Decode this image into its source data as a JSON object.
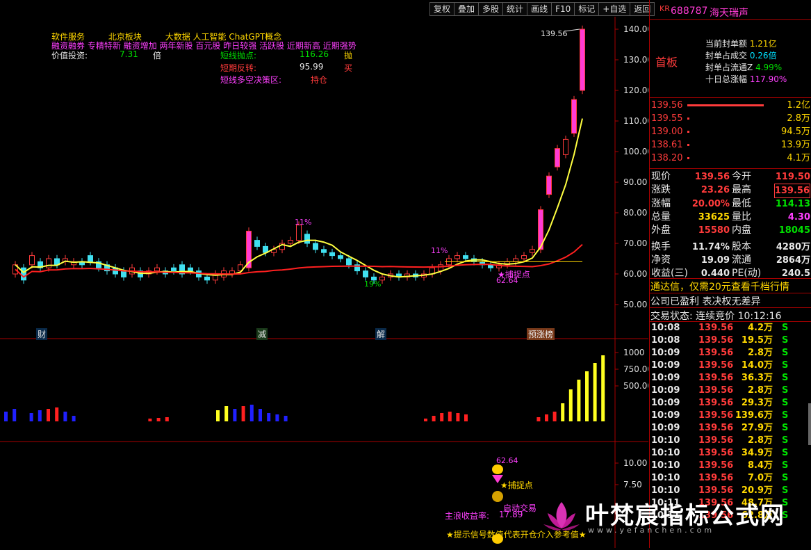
{
  "toolbar": [
    "复权",
    "叠加",
    "多股",
    "统计",
    "画线",
    "F10",
    "标记",
    "+自选",
    "返回"
  ],
  "stock": {
    "prefix": "KR",
    "code": "688787",
    "name": "海天瑞声"
  },
  "header_labels": {
    "row1": [
      "软件服务",
      "北京板块",
      "大数据",
      "人工智能",
      "ChatGPT概念"
    ],
    "row2": [
      "融资融券",
      "专精特新",
      "融资增加",
      "两年新股",
      "百元股",
      "昨日较强",
      "活跃股",
      "近期新高",
      "近期强势"
    ],
    "value_invest_label": "价值投资:",
    "value_invest_value": "7.31",
    "value_invest_unit": "倍",
    "short_sell_label": "短线抛点:",
    "short_sell_value": "116.26",
    "short_sell_action": "抛",
    "short_rev_label": "短期反转:",
    "short_rev_value": "95.99",
    "short_rev_action": "买",
    "decision_label": "短线多空决策区:",
    "decision_value": "持仓"
  },
  "price_axis": [
    "140.00",
    "130.00",
    "120.00",
    "110.00",
    "100.00",
    "90.00",
    "80.00",
    "70.00",
    "60.00",
    "50.00"
  ],
  "volume_axis": [
    "1000",
    "750.00",
    "500.00"
  ],
  "ind_axis": [
    "10.00",
    "7.50"
  ],
  "annotations": {
    "peak": "139.56",
    "pct1": "11%",
    "pct2": "11%",
    "pct3": "19%",
    "catch": "★捕捉点",
    "low": "62.64",
    "marks": [
      "财",
      "减",
      "解",
      "预涨榜"
    ]
  },
  "bottom": {
    "val": "62.64",
    "catch": "★捕捉点",
    "trade": "启动交易",
    "main_label": "主浪收益率:",
    "main_value": "17.89",
    "tip": "★提示信号数值代表开仓介入参考值★"
  },
  "limit_up": {
    "tag": "首板",
    "rows": [
      {
        "label": "当前封单额",
        "value": "1.21亿"
      },
      {
        "label": "封单占成交",
        "value": "0.26倍"
      },
      {
        "label": "封单占流通Z",
        "value": "4.99%"
      },
      {
        "label": "十日总涨幅",
        "value": "117.90%"
      }
    ]
  },
  "order_book": [
    {
      "price": "139.56",
      "vol": "1.2亿"
    },
    {
      "price": "139.55",
      "vol": "2.8万"
    },
    {
      "price": "139.00",
      "vol": "94.5万"
    },
    {
      "price": "138.61",
      "vol": "13.9万"
    },
    {
      "price": "138.20",
      "vol": "4.1万"
    }
  ],
  "quote": [
    {
      "l1": "现价",
      "v1": "139.56",
      "l2": "今开",
      "v2": "119.50"
    },
    {
      "l1": "涨跌",
      "v1": "23.26",
      "l2": "最高",
      "v2": "139.56"
    },
    {
      "l1": "涨幅",
      "v1": "20.00%",
      "l2": "最低",
      "v2": "114.13"
    },
    {
      "l1": "总量",
      "v1": "33625",
      "l2": "量比",
      "v2": "4.30"
    },
    {
      "l1": "外盘",
      "v1": "15580",
      "l2": "内盘",
      "v2": "18045"
    },
    {
      "l1": "换手",
      "v1": "11.74%",
      "l2": "股本",
      "v2": "4280万"
    },
    {
      "l1": "净资",
      "v1": "19.09",
      "l2": "流通",
      "v2": "2864万"
    },
    {
      "l1": "收益(三)",
      "v1": "0.440",
      "l2": "PE(动)",
      "v2": "240.5"
    }
  ],
  "notices": [
    "通达信，仅需20元查看千档行情",
    "公司已盈利 表决权无差异",
    "交易状态: 连续竞价 10:12:16"
  ],
  "trades": [
    {
      "t": "10:08",
      "p": "139.56",
      "v": "4.2万",
      "s": "S"
    },
    {
      "t": "10:08",
      "p": "139.56",
      "v": "19.5万",
      "s": "S"
    },
    {
      "t": "10:09",
      "p": "139.56",
      "v": "2.8万",
      "s": "S"
    },
    {
      "t": "10:09",
      "p": "139.56",
      "v": "14.0万",
      "s": "S"
    },
    {
      "t": "10:09",
      "p": "139.56",
      "v": "36.3万",
      "s": "S"
    },
    {
      "t": "10:09",
      "p": "139.56",
      "v": "2.8万",
      "s": "S"
    },
    {
      "t": "10:09",
      "p": "139.56",
      "v": "29.3万",
      "s": "S"
    },
    {
      "t": "10:09",
      "p": "139.56",
      "v": "139.6万",
      "s": "S"
    },
    {
      "t": "10:09",
      "p": "139.56",
      "v": "27.9万",
      "s": "S"
    },
    {
      "t": "10:10",
      "p": "139.56",
      "v": "2.8万",
      "s": "S"
    },
    {
      "t": "10:10",
      "p": "139.56",
      "v": "34.9万",
      "s": "S"
    },
    {
      "t": "10:10",
      "p": "139.56",
      "v": "8.4万",
      "s": "S"
    },
    {
      "t": "10:10",
      "p": "139.56",
      "v": "7.0万",
      "s": "S"
    },
    {
      "t": "10:10",
      "p": "139.56",
      "v": "20.9万",
      "s": "S"
    },
    {
      "t": "10:11",
      "p": "139.56",
      "v": "48.7万",
      "s": "S"
    },
    {
      "t": "10:11",
      "p": "139.56",
      "v": "62.8万",
      "s": "S"
    }
  ],
  "watermark": {
    "title": "叶梵宸指标公式网",
    "url": "www.yefanchen.com"
  }
}
